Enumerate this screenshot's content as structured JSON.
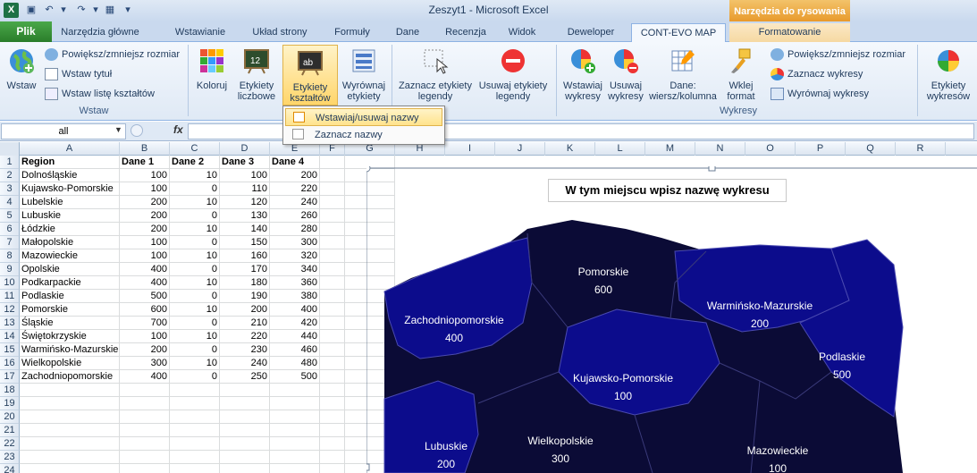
{
  "window": {
    "title": "Zeszyt1 - Microsoft Excel",
    "context_tab": "Narzędzia do rysowania"
  },
  "tabs": [
    "Plik",
    "Narzędzia główne",
    "Wstawianie",
    "Układ strony",
    "Formuły",
    "Dane",
    "Recenzja",
    "Widok",
    "Deweloper",
    "CONT-EVO MAP",
    "Formatowanie"
  ],
  "ribbon": {
    "wstaw_group": {
      "label": "Wstaw",
      "wstaw": "Wstaw",
      "resize": "Powiększ/zmniejsz rozmiar",
      "title": "Wstaw tytuł",
      "legend": "Wstaw listę kształtów"
    },
    "koloruj": "Koloruj",
    "etykiety_liczbowe": [
      "Etykiety",
      "liczbowe"
    ],
    "etykiety_ksztaltow": [
      "Etykiety",
      "kształtów"
    ],
    "wyrownaj": [
      "Wyrównaj",
      "etykiety"
    ],
    "zaznacz_leg": [
      "Zaznacz etykiety",
      "legendy"
    ],
    "usuwaj_leg": [
      "Usuwaj etykiety",
      "legendy"
    ],
    "wykresy_group": {
      "label": "Wykresy",
      "wstawiaj": [
        "Wstawiaj",
        "wykresy"
      ],
      "usuwaj": [
        "Usuwaj",
        "wykresy"
      ],
      "dane": [
        "Dane:",
        "wiersz/kolumna"
      ],
      "wklej": [
        "Wklej",
        "format"
      ],
      "resize": "Powiększ/zmniejsz rozmiar",
      "select": "Zaznacz wykresy",
      "align": "Wyrównaj wykresy",
      "etykiety": [
        "Etykiety",
        "wykresów"
      ]
    }
  },
  "dropdown": {
    "item1": "Wstawiaj/usuwaj nazwy",
    "item2": "Zaznacz nazwy"
  },
  "formula": {
    "namebox": "all",
    "fx": "fx"
  },
  "columns": [
    "A",
    "B",
    "C",
    "D",
    "E",
    "F",
    "G",
    "H",
    "I",
    "J",
    "K",
    "L",
    "M",
    "N",
    "O",
    "P",
    "Q",
    "R"
  ],
  "rows": [
    "1",
    "2",
    "3",
    "4",
    "5",
    "6",
    "7",
    "8",
    "9",
    "10",
    "11",
    "12",
    "13",
    "14",
    "15",
    "16",
    "17",
    "18",
    "19",
    "20",
    "21",
    "22",
    "23",
    "24"
  ],
  "table": {
    "headers": [
      "Region",
      "Dane 1",
      "Dane 2",
      "Dane 3",
      "Dane 4"
    ],
    "rows": [
      [
        "Dolnośląskie",
        "100",
        "10",
        "100",
        "200"
      ],
      [
        "Kujawsko-Pomorskie",
        "100",
        "0",
        "110",
        "220"
      ],
      [
        "Lubelskie",
        "200",
        "10",
        "120",
        "240"
      ],
      [
        "Lubuskie",
        "200",
        "0",
        "130",
        "260"
      ],
      [
        "Łódzkie",
        "200",
        "10",
        "140",
        "280"
      ],
      [
        "Małopolskie",
        "100",
        "0",
        "150",
        "300"
      ],
      [
        "Mazowieckie",
        "100",
        "10",
        "160",
        "320"
      ],
      [
        "Opolskie",
        "400",
        "0",
        "170",
        "340"
      ],
      [
        "Podkarpackie",
        "400",
        "10",
        "180",
        "360"
      ],
      [
        "Podlaskie",
        "500",
        "0",
        "190",
        "380"
      ],
      [
        "Pomorskie",
        "600",
        "10",
        "200",
        "400"
      ],
      [
        "Śląskie",
        "700",
        "0",
        "210",
        "420"
      ],
      [
        "Świętokrzyskie",
        "100",
        "10",
        "220",
        "440"
      ],
      [
        "Warmińsko-Mazurskie",
        "200",
        "0",
        "230",
        "460"
      ],
      [
        "Wielkopolskie",
        "300",
        "10",
        "240",
        "480"
      ],
      [
        "Zachodniopomorskie",
        "400",
        "0",
        "250",
        "500"
      ]
    ]
  },
  "chart_title": "W tym miejscu wpisz nazwę wykresu",
  "map_labels": [
    {
      "name": "Pomorskie",
      "value": "600"
    },
    {
      "name": "Warmińsko-Mazurskie",
      "value": "200"
    },
    {
      "name": "Zachodniopomorskie",
      "value": "400"
    },
    {
      "name": "Podlaskie",
      "value": "500"
    },
    {
      "name": "Kujawsko-Pomorskie",
      "value": "100"
    },
    {
      "name": "Lubuskie",
      "value": "200"
    },
    {
      "name": "Wielkopolskie",
      "value": "300"
    },
    {
      "name": "Mazowieckie",
      "value": "100"
    }
  ],
  "colors": {
    "dark_region": "#0b0b36",
    "blue_region": "#0c0c8c",
    "excel_green": "#1e7145",
    "ribbon_bg": "#dfe9f5"
  }
}
